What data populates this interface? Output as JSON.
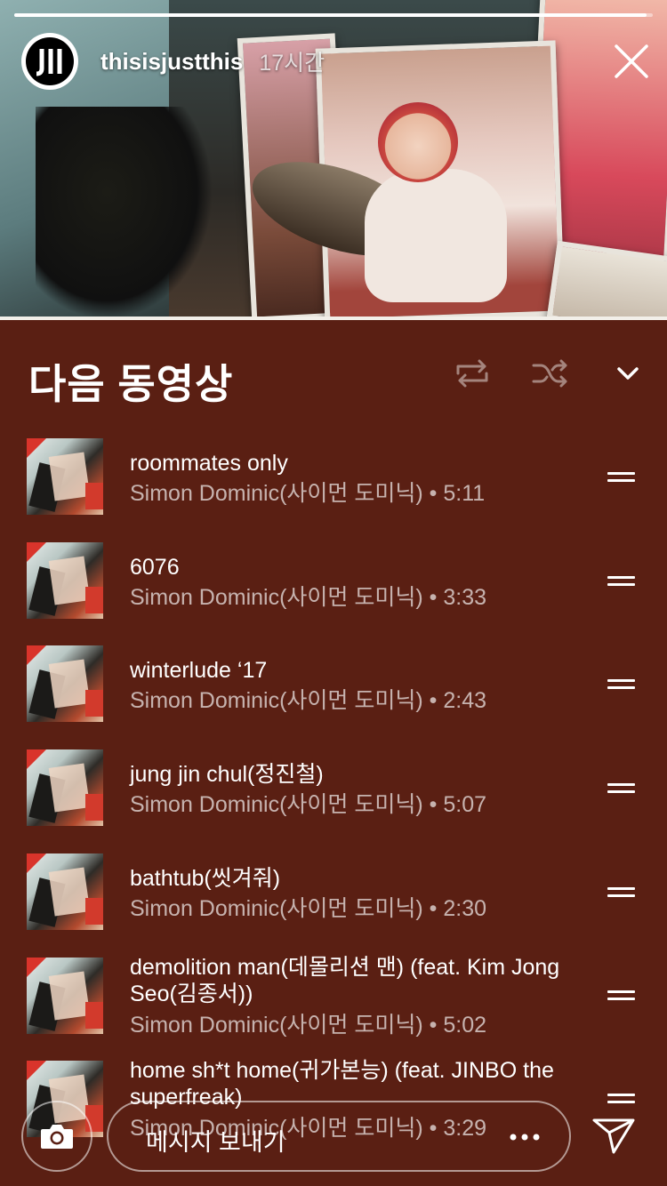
{
  "story": {
    "progress": 0.99,
    "username": "thisisjustthis",
    "time_ago": "17시간"
  },
  "queue": {
    "title": "다음 동영상",
    "tracks": [
      {
        "title": "roommates only",
        "subtitle": "Simon Dominic(사이먼 도미닉) • 5:11"
      },
      {
        "title": "6076",
        "subtitle": "Simon Dominic(사이먼 도미닉) • 3:33"
      },
      {
        "title": "winterlude ‘17",
        "subtitle": "Simon Dominic(사이먼 도미닉) • 2:43"
      },
      {
        "title": "jung jin chul(정진철)",
        "subtitle": "Simon Dominic(사이먼 도미닉) • 5:07"
      },
      {
        "title": "bathtub(씻겨줘)",
        "subtitle": "Simon Dominic(사이먼 도미닉) • 2:30"
      },
      {
        "title": "demolition man(데몰리션 맨) (feat. Kim Jong Seo(김종서))",
        "subtitle": "Simon Dominic(사이먼 도미닉) • 5:02"
      },
      {
        "title": "home sh*t home(귀가본능) (feat. JINBO the superfreak)",
        "subtitle": "Simon Dominic(사이먼 도미닉) • 3:29"
      }
    ]
  },
  "composer": {
    "placeholder": "메시지 보내기"
  },
  "icons": {
    "close": "close-icon",
    "repeat": "repeat-icon",
    "shuffle": "shuffle-icon",
    "collapse": "chevron-down-icon",
    "camera": "camera-icon",
    "more": "more-icon",
    "send": "send-icon",
    "drag": "drag-handle-icon"
  },
  "colors": {
    "panel_bg": "#5a1f13",
    "text_primary": "#ffffff",
    "text_secondary": "rgba(255,255,255,0.66)"
  }
}
